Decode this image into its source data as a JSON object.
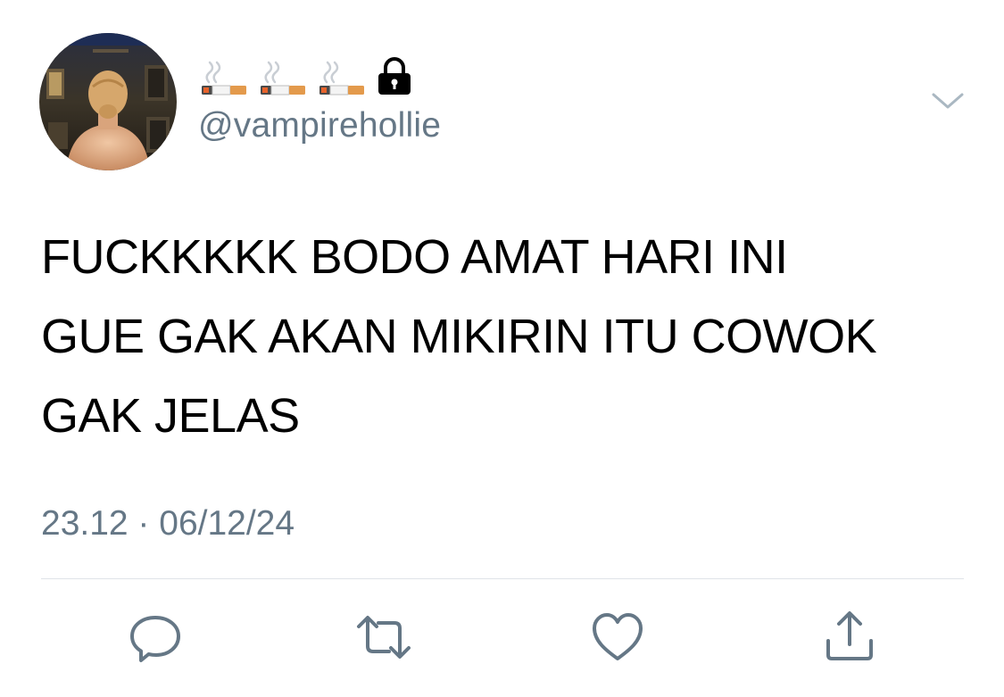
{
  "tweet": {
    "display_name_icons": [
      "cigarette-icon",
      "cigarette-icon",
      "cigarette-icon",
      "lock-icon"
    ],
    "handle": "@vampirehollie",
    "text_lines": [
      "FUCKKKKK BODO AMAT HARI INI",
      "GUE GAK AKAN MIKIRIN ITU COWOK",
      "GAK JELAS"
    ],
    "timestamp": "23.12 · 06/12/24"
  },
  "actions": [
    {
      "name": "reply",
      "icon": "reply-icon"
    },
    {
      "name": "retweet",
      "icon": "retweet-icon"
    },
    {
      "name": "like",
      "icon": "heart-icon"
    },
    {
      "name": "share",
      "icon": "share-icon"
    }
  ],
  "colors": {
    "text": "#000000",
    "secondary_text": "#657786",
    "icon": "#657786",
    "divider": "#dfe3e8",
    "background": "#ffffff"
  }
}
